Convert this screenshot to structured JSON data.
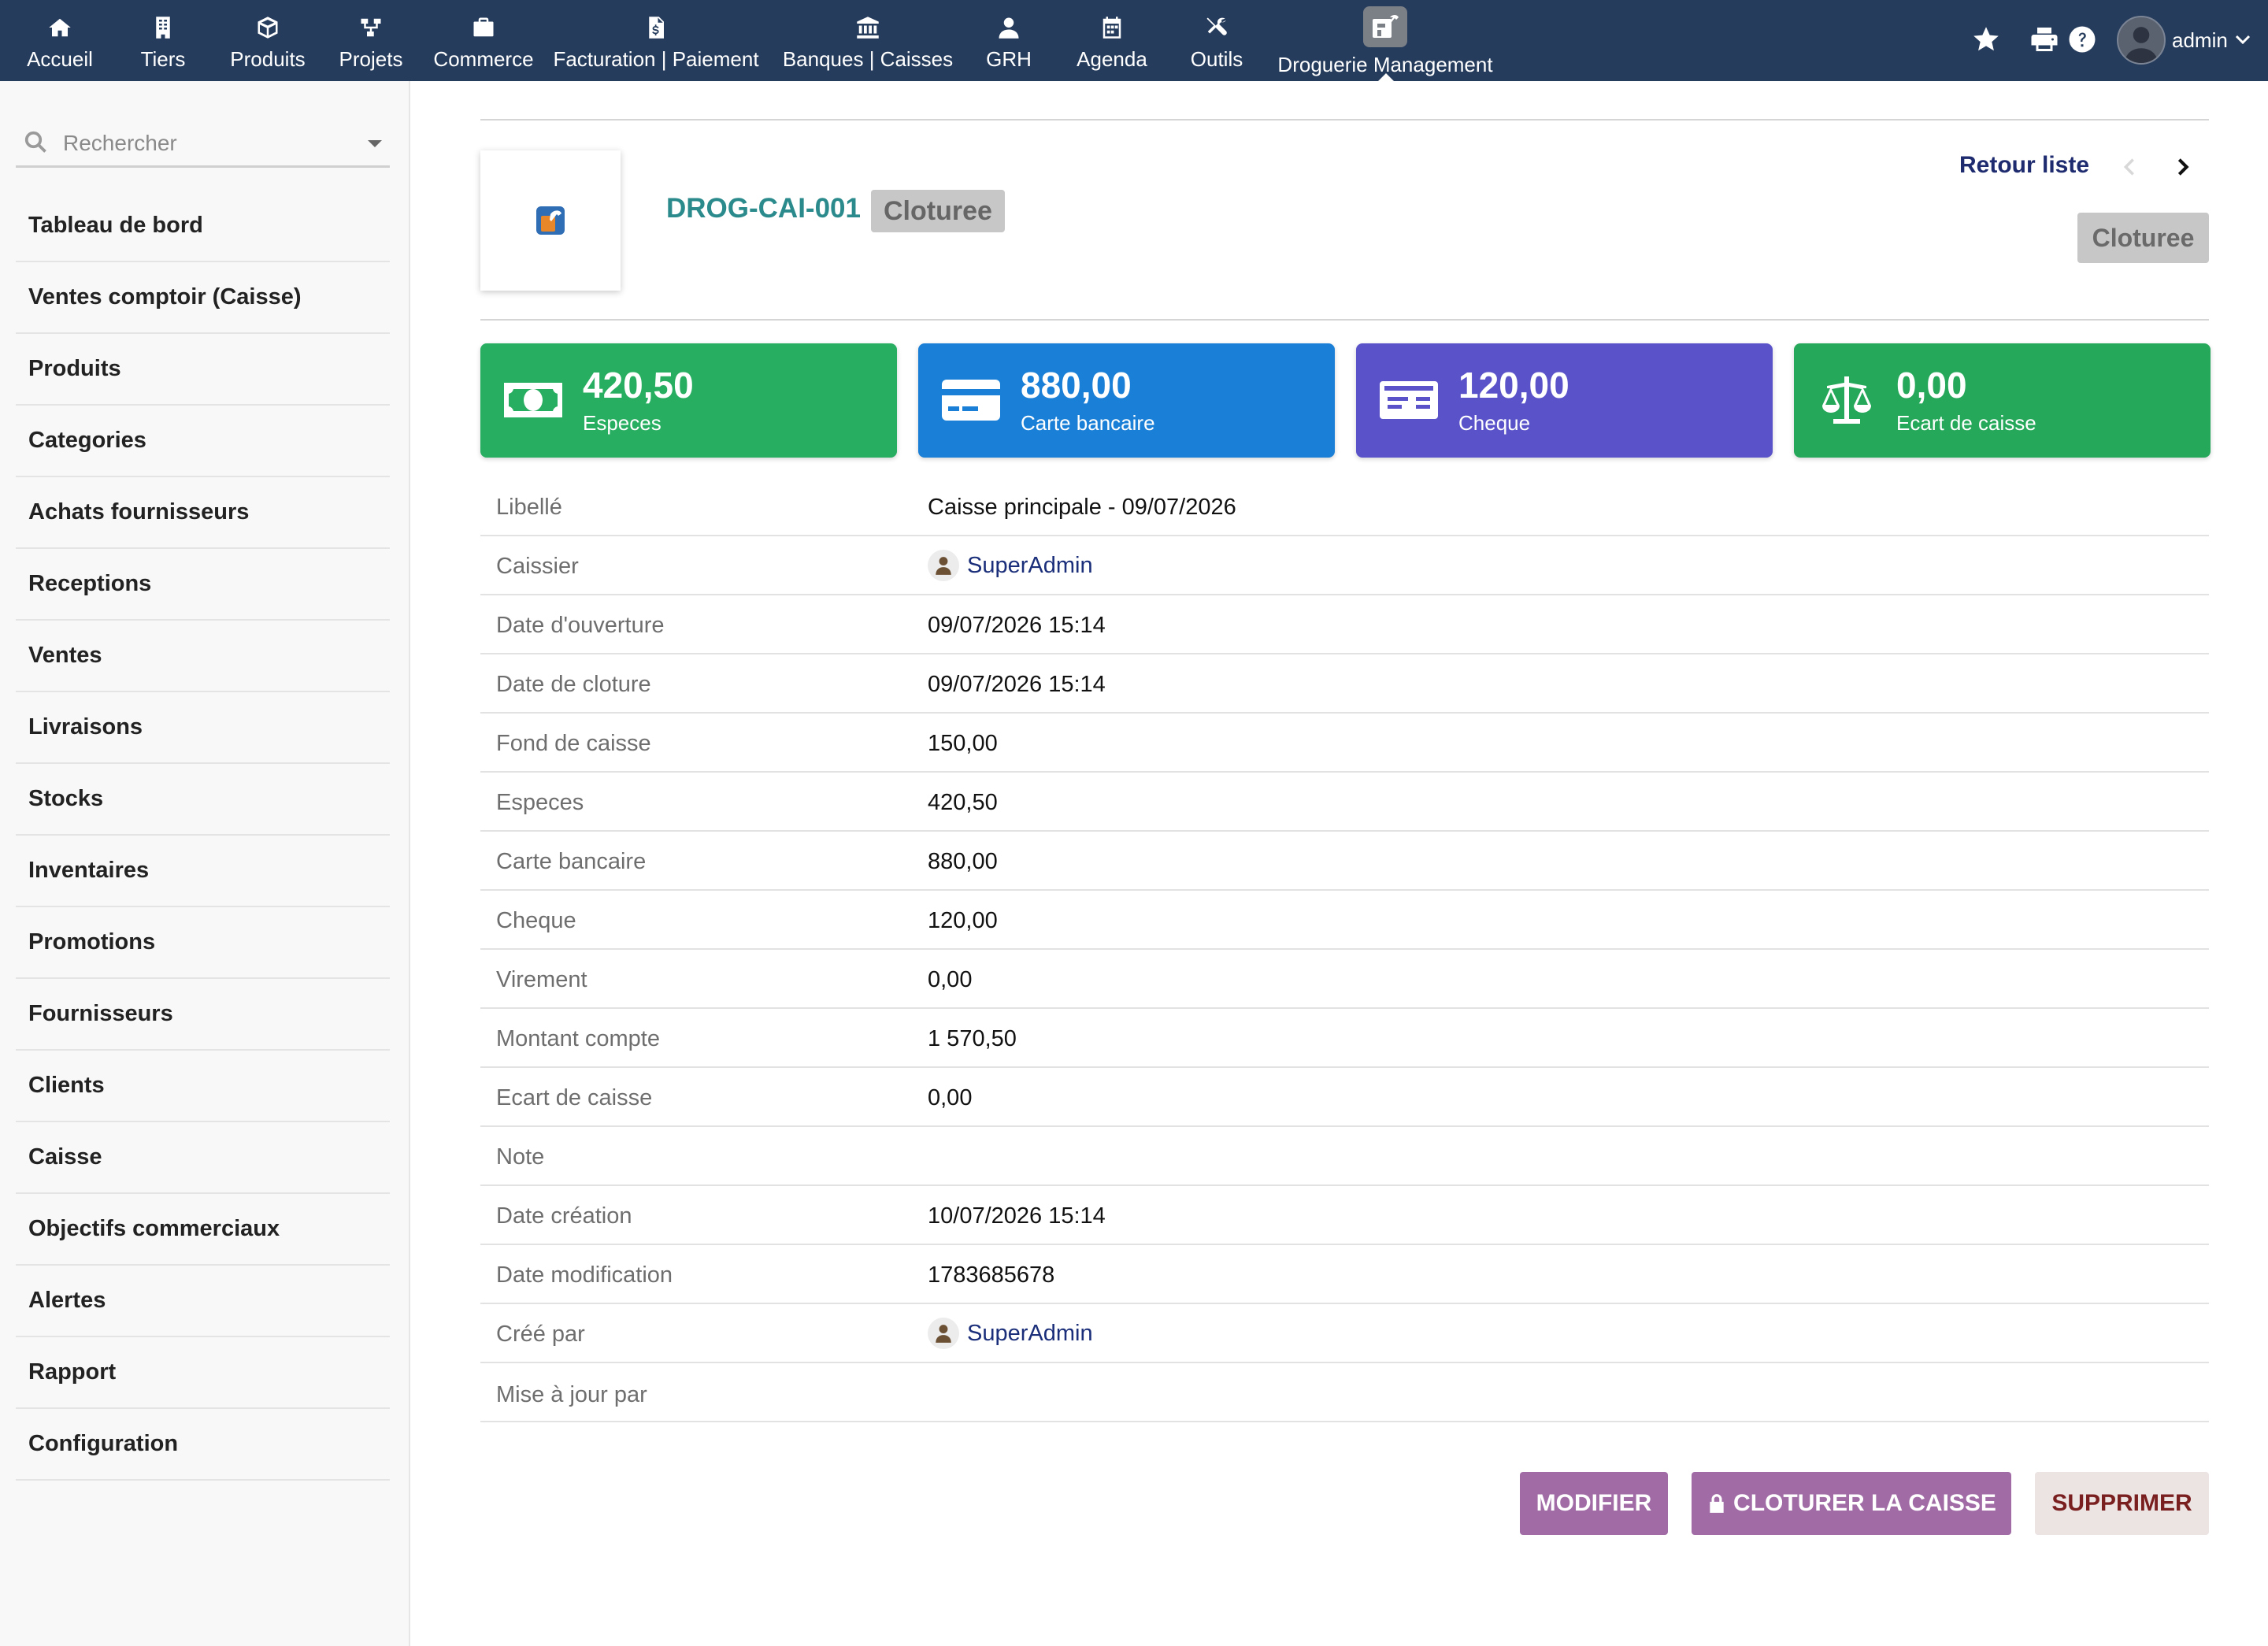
{
  "colors": {
    "topbar": "#263c5c",
    "especes_card": "#27ae60",
    "carte_card": "#1a7fd6",
    "cheque_card": "#5a52c9",
    "ecart_card": "#25a85a",
    "action_button": "#a16ba6",
    "link": "#1a2e7a",
    "ref_title": "#2b8a8c"
  },
  "topnav": {
    "items": [
      {
        "label": "Accueil",
        "icon": "home-icon"
      },
      {
        "label": "Tiers",
        "icon": "building-icon"
      },
      {
        "label": "Produits",
        "icon": "cube-icon"
      },
      {
        "label": "Projets",
        "icon": "project-tree-icon"
      },
      {
        "label": "Commerce",
        "icon": "briefcase-icon"
      },
      {
        "label": "Facturation | Paiement",
        "icon": "invoice-icon"
      },
      {
        "label": "Banques | Caisses",
        "icon": "bank-icon"
      },
      {
        "label": "GRH",
        "icon": "user-group-icon"
      },
      {
        "label": "Agenda",
        "icon": "calendar-icon"
      },
      {
        "label": "Outils",
        "icon": "tools-icon"
      },
      {
        "label": "Droguerie Management",
        "icon": "droguerie-module-icon",
        "active": true
      }
    ],
    "user": {
      "name": "admin"
    }
  },
  "sidebar": {
    "search_placeholder": "Rechercher",
    "items": [
      "Tableau de bord",
      "Ventes comptoir (Caisse)",
      "Produits",
      "Categories",
      "Achats fournisseurs",
      "Receptions",
      "Ventes",
      "Livraisons",
      "Stocks",
      "Inventaires",
      "Promotions",
      "Fournisseurs",
      "Clients",
      "Caisse",
      "Objectifs commerciaux",
      "Alertes",
      "Rapport",
      "Configuration"
    ]
  },
  "header": {
    "ref": "DROG-CAI-001",
    "status": "Cloturee",
    "back_link": "Retour liste",
    "status_right": "Cloturee"
  },
  "stats": [
    {
      "value": "420,50",
      "label": "Especes",
      "icon": "money-bill-icon"
    },
    {
      "value": "880,00",
      "label": "Carte bancaire",
      "icon": "credit-card-icon"
    },
    {
      "value": "120,00",
      "label": "Cheque",
      "icon": "cheque-icon"
    },
    {
      "value": "0,00",
      "label": "Ecart de caisse",
      "icon": "balance-scale-icon"
    }
  ],
  "details": [
    {
      "label": "Libellé",
      "value": "Caisse principale - 09/07/2026"
    },
    {
      "label": "Caissier",
      "value": "SuperAdmin",
      "is_user": true
    },
    {
      "label": "Date d'ouverture",
      "value": "09/07/2026 15:14"
    },
    {
      "label": "Date de cloture",
      "value": "09/07/2026 15:14"
    },
    {
      "label": "Fond de caisse",
      "value": "150,00"
    },
    {
      "label": "Especes",
      "value": "420,50"
    },
    {
      "label": "Carte bancaire",
      "value": "880,00"
    },
    {
      "label": "Cheque",
      "value": "120,00"
    },
    {
      "label": "Virement",
      "value": "0,00"
    },
    {
      "label": "Montant compte",
      "value": "1 570,50"
    },
    {
      "label": "Ecart de caisse",
      "value": "0,00"
    },
    {
      "label": "Note",
      "value": ""
    },
    {
      "label": "Date création",
      "value": "10/07/2026 15:14"
    },
    {
      "label": "Date modification",
      "value": "1783685678"
    },
    {
      "label": "Créé par",
      "value": "SuperAdmin",
      "is_user": true
    },
    {
      "label": "Mise à jour par",
      "value": ""
    }
  ],
  "actions": {
    "modify": "MODIFIER",
    "close": "CLOTURER LA CAISSE",
    "delete": "SUPPRIMER"
  }
}
